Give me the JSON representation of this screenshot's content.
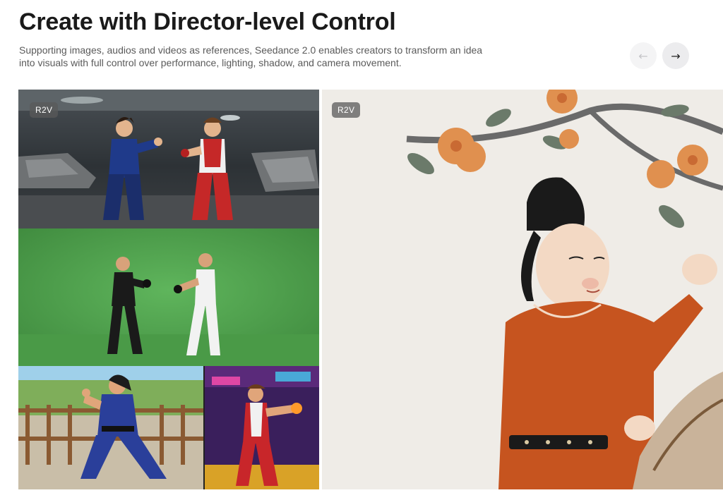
{
  "header": {
    "title": "Create with Director-level Control",
    "subtitle": "Supporting images, audios and videos as references, Seedance 2.0 enables creators to transform an idea into visuals with full control over performance, lighting, shadow, and camera movement."
  },
  "nav": {
    "prev_icon": "arrow-left-icon",
    "next_icon": "arrow-right-icon",
    "prev_glyph": "←",
    "next_glyph": "→"
  },
  "cards": [
    {
      "badge": "R2V",
      "images": [
        "arcade-fighters-parking-garage",
        "green-screen-fighters",
        "karate-fighter-park",
        "fighter-neon-street"
      ]
    },
    {
      "badge": "R2V",
      "images": [
        "tang-dynasty-figure-flowering-branch"
      ]
    }
  ]
}
